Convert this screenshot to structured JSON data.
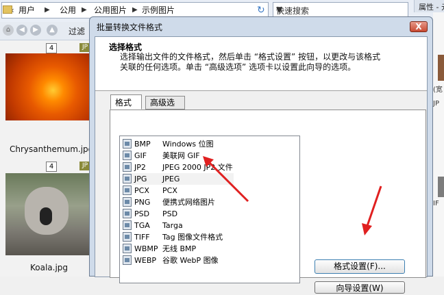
{
  "explorer": {
    "breadcrumb": [
      "用户",
      "公用",
      "公用图片",
      "示例图片"
    ],
    "search_placeholder": "快速搜索",
    "properties_label": "属性 - 元",
    "filter_label": "过滤",
    "thumbnails": [
      {
        "number": "4",
        "type": "JP",
        "caption": "Chrysanthemum.jpg"
      },
      {
        "number": "4",
        "type": "JP",
        "caption": "Koala.jpg"
      }
    ],
    "right_strip_texts": [
      "(宽",
      "JP",
      "IF"
    ]
  },
  "dialog": {
    "title": "批量转换文件格式",
    "close_label": "X",
    "heading": "选择格式",
    "description_line1": "选择输出文件的文件格式，然后单击 “格式设置” 按钮，以更改与该格式",
    "description_line2": "关联的任何选项。单击 “高级选项” 选项卡以设置此向导的选项。",
    "tabs": [
      {
        "label": "格式",
        "active": true
      },
      {
        "label": "高级选项",
        "active": false
      }
    ],
    "formats": [
      {
        "ext": "BMP",
        "name": "Windows 位图"
      },
      {
        "ext": "GIF",
        "name": "美联网 GIF"
      },
      {
        "ext": "JP2",
        "name": "JPEG 2000 JP2 文件"
      },
      {
        "ext": "JPG",
        "name": "JPEG",
        "selected": true
      },
      {
        "ext": "PCX",
        "name": "PCX"
      },
      {
        "ext": "PNG",
        "name": "便携式网络图片"
      },
      {
        "ext": "PSD",
        "name": "PSD"
      },
      {
        "ext": "TGA",
        "name": "Targa"
      },
      {
        "ext": "TIFF",
        "name": "Tag 图像文件格式"
      },
      {
        "ext": "WBMP",
        "name": "无线 BMP"
      },
      {
        "ext": "WEBP",
        "name": "谷歌 WebP 图像"
      }
    ],
    "format_settings_button": "格式设置(F)...",
    "bottom_button": "向导设置(W)"
  },
  "colors": {
    "arrow": "#e02020",
    "dialog_frame": "#cfdbea"
  }
}
